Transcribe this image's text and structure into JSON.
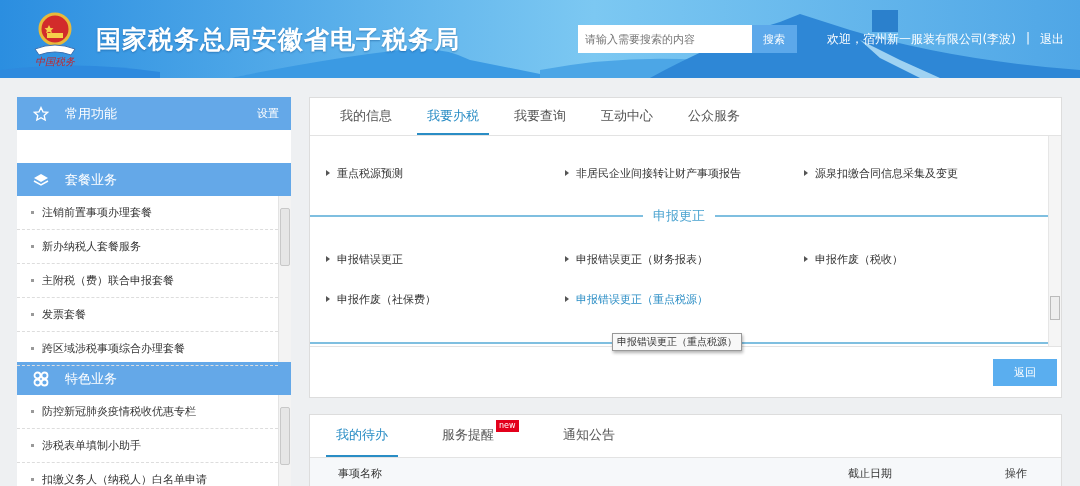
{
  "header": {
    "logo_caption": "中国税务",
    "title": "国家税务总局安徽省电子税务局",
    "search": {
      "placeholder": "请输入需要搜索的内容",
      "button": "搜索"
    },
    "welcome": "欢迎，宿州新一服装有限公司(李波)",
    "separator": "|",
    "logout": "退出"
  },
  "sidebar": {
    "sections": [
      {
        "title": "常用功能",
        "action": "设置"
      },
      {
        "title": "套餐业务",
        "items": [
          "注销前置事项办理套餐",
          "新办纳税人套餐服务",
          "主附税（费）联合申报套餐",
          "发票套餐",
          "跨区域涉税事项综合办理套餐"
        ]
      },
      {
        "title": "特色业务",
        "items": [
          "防控新冠肺炎疫情税收优惠专栏",
          "涉税表单填制小助手",
          "扣缴义务人（纳税人）白名单申请"
        ]
      }
    ]
  },
  "main": {
    "tabs": [
      {
        "label": "我的信息",
        "selected": false
      },
      {
        "label": "我要办税",
        "selected": true
      },
      {
        "label": "我要查询",
        "selected": false
      },
      {
        "label": "互动中心",
        "selected": false
      },
      {
        "label": "公众服务",
        "selected": false
      }
    ],
    "groups": [
      {
        "items": [
          {
            "label": "重点税源预测",
            "hovered": false
          },
          {
            "label": "非居民企业间接转让财产事项报告",
            "hovered": false
          },
          {
            "label": "源泉扣缴合同信息采集及变更",
            "hovered": false
          }
        ]
      },
      {
        "title": "申报更正",
        "items": [
          {
            "label": "申报错误更正",
            "hovered": false
          },
          {
            "label": "申报错误更正（财务报表）",
            "hovered": false
          },
          {
            "label": "申报作废（税收）",
            "hovered": false
          },
          {
            "label": "申报作废（社保费）",
            "hovered": false
          },
          {
            "label": "申报错误更正（重点税源）",
            "hovered": true
          }
        ]
      }
    ],
    "tooltip": "申报错误更正（重点税源）",
    "back_button": "返回"
  },
  "todo": {
    "tabs": [
      {
        "label": "我的待办",
        "selected": true
      },
      {
        "label": "服务提醒",
        "selected": false,
        "badge": "new"
      },
      {
        "label": "通知公告",
        "selected": false
      }
    ],
    "columns": [
      "事项名称",
      "截止日期",
      "操作"
    ]
  }
}
